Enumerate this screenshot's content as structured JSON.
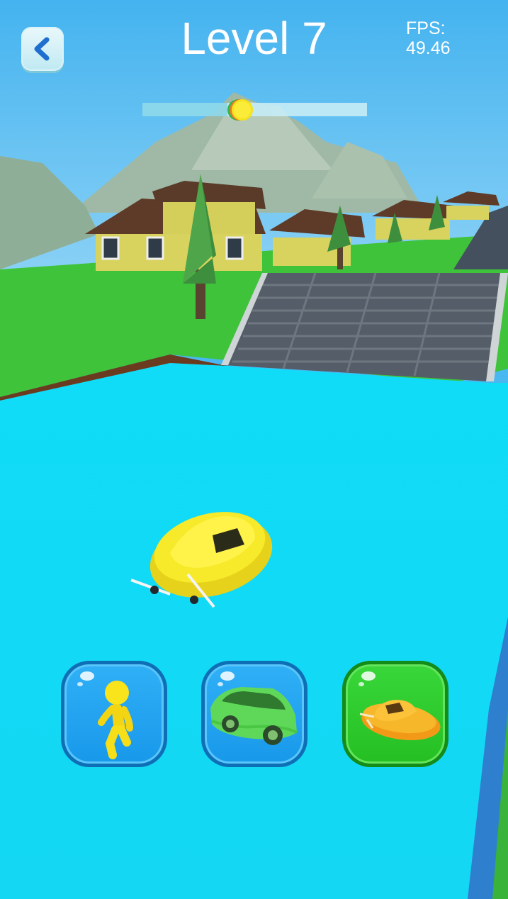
{
  "hud": {
    "level_title": "Level 7",
    "fps_label": "FPS:",
    "fps_value": "49.46",
    "back_icon": "chevron-left-icon",
    "level_progress": 0.38
  },
  "vehicle_selector": {
    "selected": "hovercraft",
    "options": [
      {
        "id": "runner",
        "icon": "stickman-runner-icon",
        "selected": false
      },
      {
        "id": "car",
        "icon": "green-car-icon",
        "selected": false
      },
      {
        "id": "hovercraft",
        "icon": "hovercraft-icon",
        "selected": true
      }
    ]
  },
  "colors": {
    "sky": "#49b8f0",
    "water": "#12dcf6",
    "grass": "#3fc33a",
    "player": "#f5e51c",
    "selected_button": "#2ec82b",
    "unselected_button": "#1e9ff0"
  }
}
